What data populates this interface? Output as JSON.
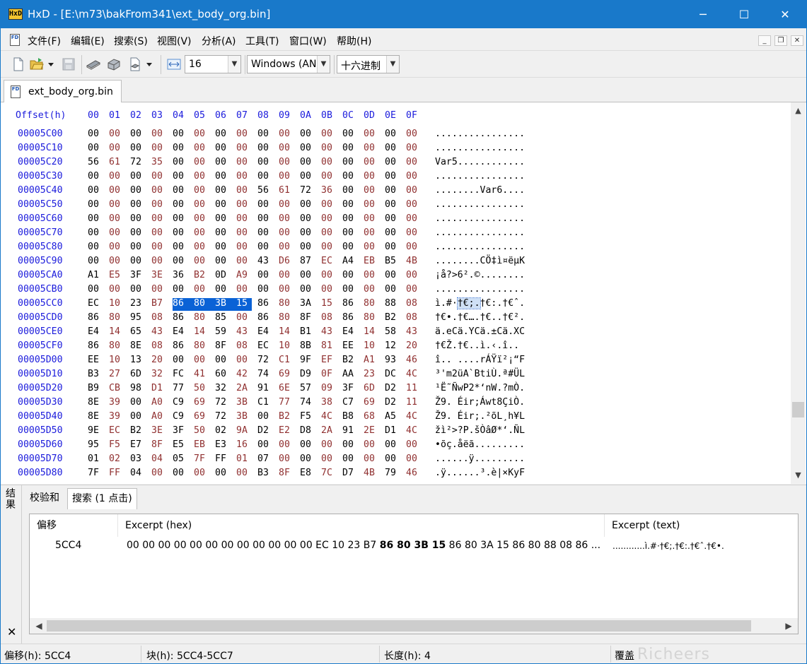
{
  "window": {
    "app_icon_text": "HxD",
    "title": "HxD - [E:\\m73\\bakFrom341\\ext_body_org.bin]",
    "min_glyph": "─",
    "max_glyph": "☐",
    "close_glyph": "✕"
  },
  "menu": {
    "icon_text": "FD",
    "items": [
      "文件(F)",
      "编辑(E)",
      "搜索(S)",
      "视图(V)",
      "分析(A)",
      "工具(T)",
      "窗口(W)",
      "帮助(H)"
    ],
    "mdi_min": "_",
    "mdi_restore": "❐",
    "mdi_close": "✕"
  },
  "toolbar": {
    "bytes_per_row": "16",
    "charset": "Windows (ANSI)",
    "offset_base": "十六进制",
    "icons": [
      "new-file-icon",
      "open-folder-icon",
      "save-icon",
      "ram-icon",
      "disk-icon",
      "disk-image-icon",
      "arrows-width-icon"
    ]
  },
  "tabs": {
    "file_icon_text": "FD",
    "file": "ext_body_org.bin"
  },
  "hexview": {
    "header_offset": "Offset(h)",
    "columns": [
      "00",
      "01",
      "02",
      "03",
      "04",
      "05",
      "06",
      "07",
      "08",
      "09",
      "0A",
      "0B",
      "0C",
      "0D",
      "0E",
      "0F"
    ],
    "rows": [
      {
        "offset": "00005C00",
        "bytes": [
          "00",
          "00",
          "00",
          "00",
          "00",
          "00",
          "00",
          "00",
          "00",
          "00",
          "00",
          "00",
          "00",
          "00",
          "00",
          "00"
        ],
        "text": "................"
      },
      {
        "offset": "00005C10",
        "bytes": [
          "00",
          "00",
          "00",
          "00",
          "00",
          "00",
          "00",
          "00",
          "00",
          "00",
          "00",
          "00",
          "00",
          "00",
          "00",
          "00"
        ],
        "text": "................"
      },
      {
        "offset": "00005C20",
        "bytes": [
          "56",
          "61",
          "72",
          "35",
          "00",
          "00",
          "00",
          "00",
          "00",
          "00",
          "00",
          "00",
          "00",
          "00",
          "00",
          "00"
        ],
        "text": "Var5............"
      },
      {
        "offset": "00005C30",
        "bytes": [
          "00",
          "00",
          "00",
          "00",
          "00",
          "00",
          "00",
          "00",
          "00",
          "00",
          "00",
          "00",
          "00",
          "00",
          "00",
          "00"
        ],
        "text": "................"
      },
      {
        "offset": "00005C40",
        "bytes": [
          "00",
          "00",
          "00",
          "00",
          "00",
          "00",
          "00",
          "00",
          "56",
          "61",
          "72",
          "36",
          "00",
          "00",
          "00",
          "00"
        ],
        "text": "........Var6...."
      },
      {
        "offset": "00005C50",
        "bytes": [
          "00",
          "00",
          "00",
          "00",
          "00",
          "00",
          "00",
          "00",
          "00",
          "00",
          "00",
          "00",
          "00",
          "00",
          "00",
          "00"
        ],
        "text": "................"
      },
      {
        "offset": "00005C60",
        "bytes": [
          "00",
          "00",
          "00",
          "00",
          "00",
          "00",
          "00",
          "00",
          "00",
          "00",
          "00",
          "00",
          "00",
          "00",
          "00",
          "00"
        ],
        "text": "................"
      },
      {
        "offset": "00005C70",
        "bytes": [
          "00",
          "00",
          "00",
          "00",
          "00",
          "00",
          "00",
          "00",
          "00",
          "00",
          "00",
          "00",
          "00",
          "00",
          "00",
          "00"
        ],
        "text": "................"
      },
      {
        "offset": "00005C80",
        "bytes": [
          "00",
          "00",
          "00",
          "00",
          "00",
          "00",
          "00",
          "00",
          "00",
          "00",
          "00",
          "00",
          "00",
          "00",
          "00",
          "00"
        ],
        "text": "................"
      },
      {
        "offset": "00005C90",
        "bytes": [
          "00",
          "00",
          "00",
          "00",
          "00",
          "00",
          "00",
          "00",
          "43",
          "D6",
          "87",
          "EC",
          "A4",
          "EB",
          "B5",
          "4B"
        ],
        "text": "........CÖ‡ì¤ëµK"
      },
      {
        "offset": "00005CA0",
        "bytes": [
          "A1",
          "E5",
          "3F",
          "3E",
          "36",
          "B2",
          "0D",
          "A9",
          "00",
          "00",
          "00",
          "00",
          "00",
          "00",
          "00",
          "00"
        ],
        "text": "¡å?>6².©........"
      },
      {
        "offset": "00005CB0",
        "bytes": [
          "00",
          "00",
          "00",
          "00",
          "00",
          "00",
          "00",
          "00",
          "00",
          "00",
          "00",
          "00",
          "00",
          "00",
          "00",
          "00"
        ],
        "text": "................"
      },
      {
        "offset": "00005CC0",
        "bytes": [
          "EC",
          "10",
          "23",
          "B7",
          "86",
          "80",
          "3B",
          "15",
          "86",
          "80",
          "3A",
          "15",
          "86",
          "80",
          "88",
          "08"
        ],
        "text": "ì.#·†€;.†€:.†€ˆ.",
        "sel_start": 4,
        "sel_end": 7,
        "text_pre": "ì.#·",
        "text_sel": "†€;.",
        "text_post": "†€:.†€ˆ."
      },
      {
        "offset": "00005CD0",
        "bytes": [
          "86",
          "80",
          "95",
          "08",
          "86",
          "80",
          "85",
          "00",
          "86",
          "80",
          "8F",
          "08",
          "86",
          "80",
          "B2",
          "08"
        ],
        "text": "†€•.†€….†€..†€²."
      },
      {
        "offset": "00005CE0",
        "bytes": [
          "E4",
          "14",
          "65",
          "43",
          "E4",
          "14",
          "59",
          "43",
          "E4",
          "14",
          "B1",
          "43",
          "E4",
          "14",
          "58",
          "43"
        ],
        "text": "ä.eCä.YCä.±Cä.XC"
      },
      {
        "offset": "00005CF0",
        "bytes": [
          "86",
          "80",
          "8E",
          "08",
          "86",
          "80",
          "8F",
          "08",
          "EC",
          "10",
          "8B",
          "81",
          "EE",
          "10",
          "12",
          "20"
        ],
        "text": "†€Ž.†€..ì.‹.î.. "
      },
      {
        "offset": "00005D00",
        "bytes": [
          "EE",
          "10",
          "13",
          "20",
          "00",
          "00",
          "00",
          "00",
          "72",
          "C1",
          "9F",
          "EF",
          "B2",
          "A1",
          "93",
          "46"
        ],
        "text": "î.. ....rÁŸï²¡“F"
      },
      {
        "offset": "00005D10",
        "bytes": [
          "B3",
          "27",
          "6D",
          "32",
          "FC",
          "41",
          "60",
          "42",
          "74",
          "69",
          "D9",
          "0F",
          "AA",
          "23",
          "DC",
          "4C"
        ],
        "text": "³'m2üA`BtiÙ.ª#ÜL"
      },
      {
        "offset": "00005D20",
        "bytes": [
          "B9",
          "CB",
          "98",
          "D1",
          "77",
          "50",
          "32",
          "2A",
          "91",
          "6E",
          "57",
          "09",
          "3F",
          "6D",
          "D2",
          "11"
        ],
        "text": "¹Ë˜ÑwP2*‘nW.?mÒ."
      },
      {
        "offset": "00005D30",
        "bytes": [
          "8E",
          "39",
          "00",
          "A0",
          "C9",
          "69",
          "72",
          "3B",
          "C1",
          "77",
          "74",
          "38",
          "C7",
          "69",
          "D2",
          "11"
        ],
        "text": "Ž9. Éir;Áwt8ÇiÒ."
      },
      {
        "offset": "00005D40",
        "bytes": [
          "8E",
          "39",
          "00",
          "A0",
          "C9",
          "69",
          "72",
          "3B",
          "00",
          "B2",
          "F5",
          "4C",
          "B8",
          "68",
          "A5",
          "4C"
        ],
        "text": "Ž9. Éir;.²õL¸h¥L"
      },
      {
        "offset": "00005D50",
        "bytes": [
          "9E",
          "EC",
          "B2",
          "3E",
          "3F",
          "50",
          "02",
          "9A",
          "D2",
          "E2",
          "D8",
          "2A",
          "91",
          "2E",
          "D1",
          "4C"
        ],
        "text": "žì²>?P.šÒâØ*‘.ÑL"
      },
      {
        "offset": "00005D60",
        "bytes": [
          "95",
          "F5",
          "E7",
          "8F",
          "E5",
          "EB",
          "E3",
          "16",
          "00",
          "00",
          "00",
          "00",
          "00",
          "00",
          "00",
          "00"
        ],
        "text": "•õç.åëã........."
      },
      {
        "offset": "00005D70",
        "bytes": [
          "01",
          "02",
          "03",
          "04",
          "05",
          "7F",
          "FF",
          "01",
          "07",
          "00",
          "00",
          "00",
          "00",
          "00",
          "00",
          "00"
        ],
        "text": "......ÿ........."
      },
      {
        "offset": "00005D80",
        "bytes": [
          "7F",
          "FF",
          "04",
          "00",
          "00",
          "00",
          "00",
          "00",
          "B3",
          "8F",
          "E8",
          "7C",
          "D7",
          "4B",
          "79",
          "46"
        ],
        "text": ".ÿ......³.è|×KyF"
      }
    ],
    "scroll_up": "▲",
    "scroll_down": "▼"
  },
  "results": {
    "side_label": "结果",
    "close": "✕",
    "tabs": [
      "校验和",
      "搜索 (1 点击)"
    ],
    "columns": [
      "偏移",
      "Excerpt (hex)",
      "Excerpt (text)"
    ],
    "row": {
      "offset": "5CC4",
      "hex_pre": "00 00 00 00 00 00 00 00 00 00 00 00 EC 10 23 B7 ",
      "hex_match": "86 80 3B 15",
      "hex_post": " 86 80 3A 15 86 80 88 08 86 ...",
      "text": "............ì.#·†€;.†€:.†€ˆ.†€•."
    },
    "scroll_left": "◀",
    "scroll_right": "▶"
  },
  "status": {
    "offset": "偏移(h): 5CC4",
    "block": "块(h): 5CC4-5CC7",
    "length": "长度(h): 4",
    "mode": "覆盖",
    "watermark": "Richeers"
  }
}
